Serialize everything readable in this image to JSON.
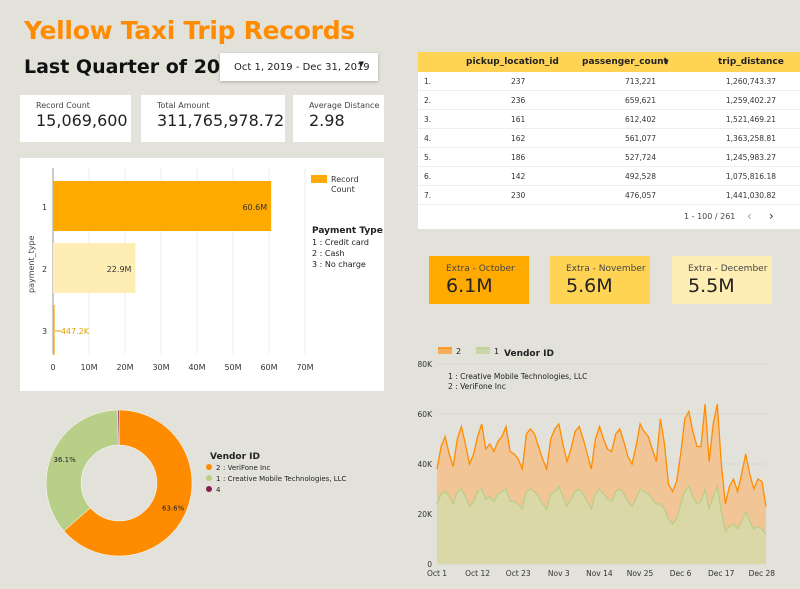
{
  "header": {
    "title": "Yellow Taxi Trip Records",
    "subtitle": "Last Quarter of 2019",
    "date_range": "Oct 1, 2019 - Dec 31, 2019"
  },
  "kpis": [
    {
      "label": "Record Count",
      "value": "15,069,600"
    },
    {
      "label": "Total Amount",
      "value": "311,765,978.72"
    },
    {
      "label": "Average Distance",
      "value": "2.98"
    }
  ],
  "payment_chart": {
    "legend_label_1": "Record",
    "legend_label_2": "Count",
    "notes_title": "Payment Type",
    "notes": [
      "1 : Credit card",
      "2 : Cash",
      "3 : No charge"
    ]
  },
  "table": {
    "columns": [
      "pickup_location_id",
      "passenger_count",
      "trip_distance"
    ],
    "sort_indicator": "▼",
    "rows": [
      {
        "n": "1.",
        "pickup": "237",
        "passengers": "713,221",
        "distance": "1,260,743.37"
      },
      {
        "n": "2.",
        "pickup": "236",
        "passengers": "659,621",
        "distance": "1,259,402.27"
      },
      {
        "n": "3.",
        "pickup": "161",
        "passengers": "612,402",
        "distance": "1,521,469.21"
      },
      {
        "n": "4.",
        "pickup": "162",
        "passengers": "561,077",
        "distance": "1,363,258.81"
      },
      {
        "n": "5.",
        "pickup": "186",
        "passengers": "527,724",
        "distance": "1,245,983.27"
      },
      {
        "n": "6.",
        "pickup": "142",
        "passengers": "492,528",
        "distance": "1,075,816.18"
      },
      {
        "n": "7.",
        "pickup": "230",
        "passengers": "476,057",
        "distance": "1,441,030.82"
      }
    ],
    "pagination": "1 - 100 / 261"
  },
  "extras": [
    {
      "label": "Extra - October",
      "value": "6.1M",
      "color": "#ffaa00"
    },
    {
      "label": "Extra - November",
      "value": "5.6M",
      "color": "#ffd454"
    },
    {
      "label": "Extra - December",
      "value": "5.5M",
      "color": "#ffeeb3"
    }
  ],
  "vendor_donut": {
    "title": "Vendor ID",
    "legend": [
      {
        "key": "2",
        "label": ": VeriFone Inc",
        "color": "#ff8c00"
      },
      {
        "key": "1",
        "label": ": Creative Mobile Technologies, LLC",
        "color": "#b8cf88"
      },
      {
        "key": "4",
        "label": "",
        "color": "#8b1a4a"
      }
    ]
  },
  "vendor_area": {
    "title": "Vendor ID",
    "legend_keys": [
      "2",
      "1"
    ],
    "notes": [
      "1 : Creative Mobile Technologies, LLC",
      "2 : VeriFone Inc"
    ]
  },
  "colors": {
    "accent": "#ff8c00",
    "bar_primary": "#ffaa00",
    "bar_light": "#ffeeb3",
    "table_header": "#ffd454",
    "vendor2": "#ff8c00",
    "vendor1": "#b8cf88"
  },
  "chart_data": [
    {
      "type": "bar",
      "orientation": "horizontal",
      "categories": [
        "1",
        "2",
        "3"
      ],
      "values": [
        60.6,
        22.9,
        0.4472
      ],
      "data_labels": [
        "60.6M",
        "22.9M",
        "447.2K"
      ],
      "ylabel": "payment_type",
      "xticks": [
        "0",
        "10M",
        "20M",
        "30M",
        "40M",
        "50M",
        "60M",
        "70M"
      ],
      "xlim": [
        0,
        70
      ],
      "series": [
        {
          "name": "Record Count",
          "values": [
            60.6,
            22.9,
            0.4472
          ]
        }
      ]
    },
    {
      "type": "pie",
      "donut": true,
      "slices": [
        {
          "name": "2",
          "value": 63.6,
          "label": "63.6%"
        },
        {
          "name": "1",
          "value": 36.1,
          "label": "36.1%"
        },
        {
          "name": "4",
          "value": 0.3,
          "label": ""
        }
      ]
    },
    {
      "type": "area",
      "xticks": [
        "Oct 1",
        "Oct 12",
        "Oct 23",
        "Nov 3",
        "Nov 14",
        "Nov 25",
        "Dec 6",
        "Dec 17",
        "Dec 28"
      ],
      "yticks": [
        "0",
        "20K",
        "40K",
        "60K",
        "80K"
      ],
      "ylim": [
        0,
        80
      ],
      "series": [
        {
          "name": "2",
          "values": [
            38,
            47,
            51,
            44,
            39,
            50,
            55,
            48,
            40,
            44,
            51,
            56,
            46,
            48,
            45,
            49,
            51,
            55,
            45,
            44,
            42,
            38,
            52,
            54,
            52,
            47,
            42,
            38,
            50,
            54,
            56,
            48,
            41,
            46,
            53,
            55,
            50,
            44,
            38,
            50,
            55,
            50,
            46,
            45,
            52,
            54,
            49,
            43,
            40,
            47,
            56,
            53,
            51,
            46,
            41,
            58,
            48,
            32,
            29,
            33,
            44,
            58,
            61,
            53,
            47,
            47,
            64,
            41,
            56,
            64,
            40,
            24,
            31,
            34,
            29,
            36,
            44,
            36,
            30,
            34,
            33,
            23
          ]
        },
        {
          "name": "1",
          "values": [
            24,
            28,
            29,
            27,
            24,
            29,
            30,
            27,
            23,
            25,
            29,
            30,
            26,
            27,
            25,
            28,
            29,
            30,
            25,
            25,
            24,
            22,
            29,
            30,
            29,
            27,
            24,
            22,
            28,
            29,
            31,
            27,
            23,
            26,
            29,
            30,
            28,
            25,
            22,
            28,
            30,
            28,
            26,
            25,
            29,
            30,
            28,
            25,
            23,
            26,
            30,
            29,
            28,
            26,
            24,
            24,
            22,
            18,
            16,
            18,
            24,
            29,
            31,
            27,
            24,
            25,
            30,
            22,
            27,
            31,
            21,
            13,
            15,
            16,
            14,
            17,
            21,
            17,
            14,
            15,
            14,
            12
          ]
        }
      ]
    }
  ]
}
